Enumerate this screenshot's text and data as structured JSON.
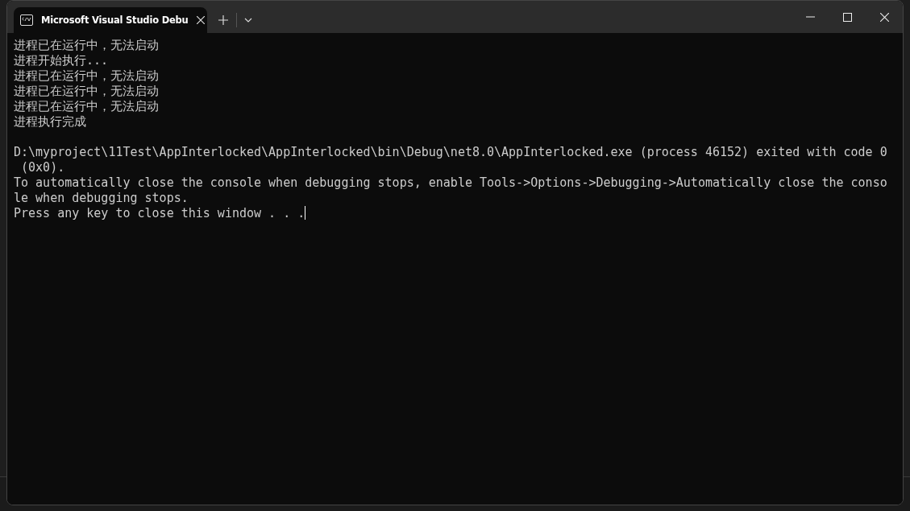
{
  "tab": {
    "title": "Microsoft Visual Studio Debu",
    "selected": true
  },
  "console": {
    "lines": [
      "进程已在运行中，无法启动",
      "进程开始执行...",
      "进程已在运行中，无法启动",
      "进程已在运行中，无法启动",
      "进程已在运行中，无法启动",
      "进程执行完成"
    ],
    "exit_lines": [
      "D:\\myproject\\11Test\\AppInterlocked\\AppInterlocked\\bin\\Debug\\net8.0\\AppInterlocked.exe (process 46152) exited with code 0",
      " (0x0).",
      "To automatically close the console when debugging stops, enable Tools->Options->Debugging->Automatically close the conso",
      "le when debugging stops.",
      "Press any key to close this window . . ."
    ],
    "cursor": true
  }
}
